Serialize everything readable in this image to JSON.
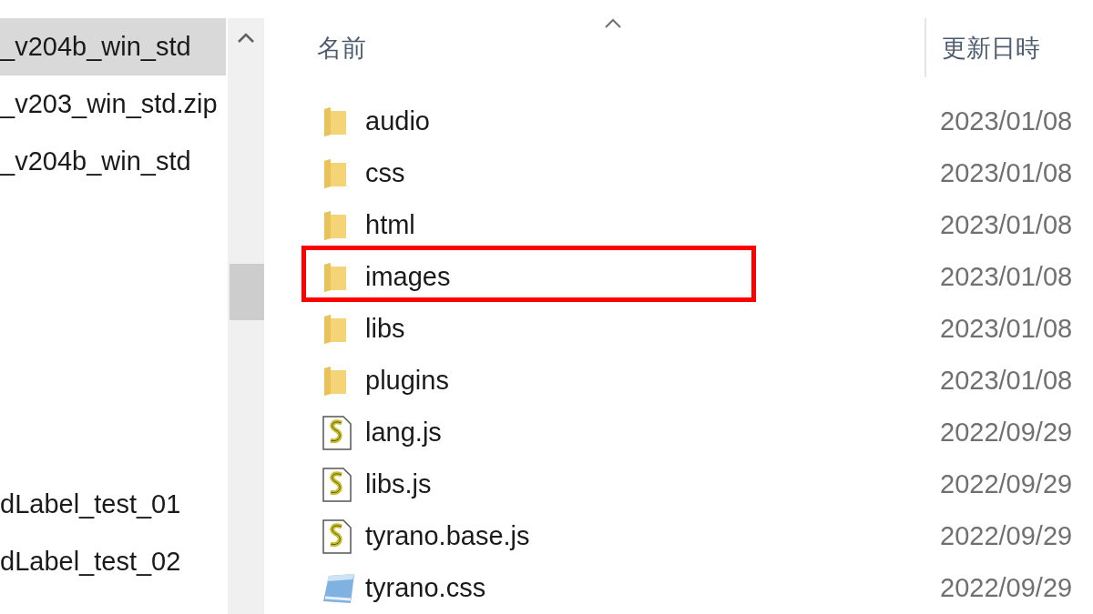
{
  "nav": {
    "sections": [
      {
        "items": [
          {
            "label": "_v204b_win_std",
            "selected": true
          },
          {
            "label": "_v203_win_std.zip",
            "selected": false
          },
          {
            "label": "_v204b_win_std",
            "selected": false
          }
        ]
      },
      {
        "items": [
          {
            "label": "dLabel_test_01",
            "selected": false
          },
          {
            "label": "dLabel_test_02",
            "selected": false
          }
        ]
      }
    ]
  },
  "file_list": {
    "columns": [
      {
        "label": "名前",
        "sorted": true
      },
      {
        "label": "更新日時",
        "sorted": false
      }
    ],
    "rows": [
      {
        "kind": "folder",
        "name": "audio",
        "modified": "2023/01/08",
        "annotated": false
      },
      {
        "kind": "folder",
        "name": "css",
        "modified": "2023/01/08",
        "annotated": false
      },
      {
        "kind": "folder",
        "name": "html",
        "modified": "2023/01/08",
        "annotated": false
      },
      {
        "kind": "folder",
        "name": "images",
        "modified": "2023/01/08",
        "annotated": true
      },
      {
        "kind": "folder",
        "name": "libs",
        "modified": "2023/01/08",
        "annotated": false
      },
      {
        "kind": "folder",
        "name": "plugins",
        "modified": "2023/01/08",
        "annotated": false
      },
      {
        "kind": "script",
        "name": "lang.js",
        "modified": "2022/09/29",
        "annotated": false
      },
      {
        "kind": "script",
        "name": "libs.js",
        "modified": "2022/09/29",
        "annotated": false
      },
      {
        "kind": "script",
        "name": "tyrano.base.js",
        "modified": "2022/09/29",
        "annotated": false
      },
      {
        "kind": "stylesheet",
        "name": "tyrano.css",
        "modified": "2022/09/29",
        "annotated": false
      }
    ]
  }
}
